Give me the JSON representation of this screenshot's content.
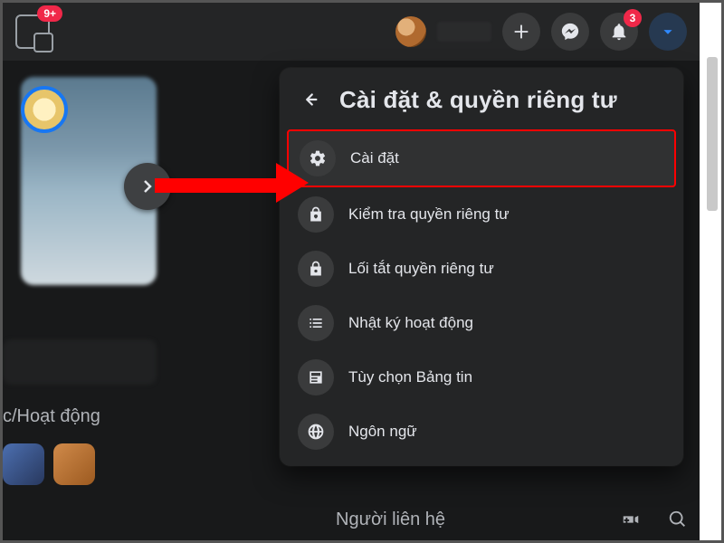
{
  "topbar": {
    "watch_badge": "9+",
    "notif_badge": "3"
  },
  "leftcol": {
    "activity_label": "c/Hoạt động"
  },
  "dropdown": {
    "title": "Cài đặt & quyền riêng tư",
    "items": [
      {
        "label": "Cài đặt",
        "icon": "gear-icon",
        "highlighted": true
      },
      {
        "label": "Kiểm tra quyền riêng tư",
        "icon": "lock-heart-icon"
      },
      {
        "label": "Lối tắt quyền riêng tư",
        "icon": "lock-icon"
      },
      {
        "label": "Nhật ký hoạt động",
        "icon": "list-icon"
      },
      {
        "label": "Tùy chọn Bảng tin",
        "icon": "feed-icon"
      },
      {
        "label": "Ngôn ngữ",
        "icon": "globe-icon"
      }
    ]
  },
  "footer": {
    "contacts_label": "Người liên hệ"
  },
  "colors": {
    "background": "#18191a",
    "panel": "#242526",
    "hover": "#3a3b3c",
    "text": "#e4e6eb",
    "badge_red": "#f02849",
    "accent_blue": "#2374e1",
    "highlight_border": "#ff0000"
  }
}
